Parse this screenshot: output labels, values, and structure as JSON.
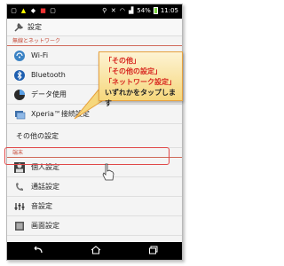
{
  "status_bar": {
    "battery": "54%",
    "time": "11:05"
  },
  "action_bar": {
    "title": "設定",
    "icon": "wrench-icon"
  },
  "sections": {
    "wireless": "無線とネットワーク",
    "device": "端末"
  },
  "items": [
    {
      "label": "Wi-Fi",
      "icon": "wifi-icon"
    },
    {
      "label": "Bluetooth",
      "icon": "bluetooth-icon"
    },
    {
      "label": "データ使用",
      "icon": "data-usage-icon"
    },
    {
      "label": "Xperia™接続設定",
      "icon": "xperia-connect-icon"
    },
    {
      "label": "その他の設定",
      "icon": ""
    },
    {
      "label": "個人設定",
      "icon": "personal-icon"
    },
    {
      "label": "通話設定",
      "icon": "call-icon"
    },
    {
      "label": "音設定",
      "icon": "sound-icon"
    },
    {
      "label": "画面設定",
      "icon": "display-icon"
    }
  ],
  "callout": {
    "line1": "「その他」",
    "line2": "「その他の設定」",
    "line3": "「ネットワーク設定」",
    "line4": "いずれかをタップします"
  },
  "nav_bar": {
    "back": "back-icon",
    "home": "home-icon",
    "recent": "recent-apps-icon"
  },
  "colors": {
    "accent": "#9e1a2e",
    "callout_red": "#d7261e",
    "highlight": "#e04848"
  }
}
